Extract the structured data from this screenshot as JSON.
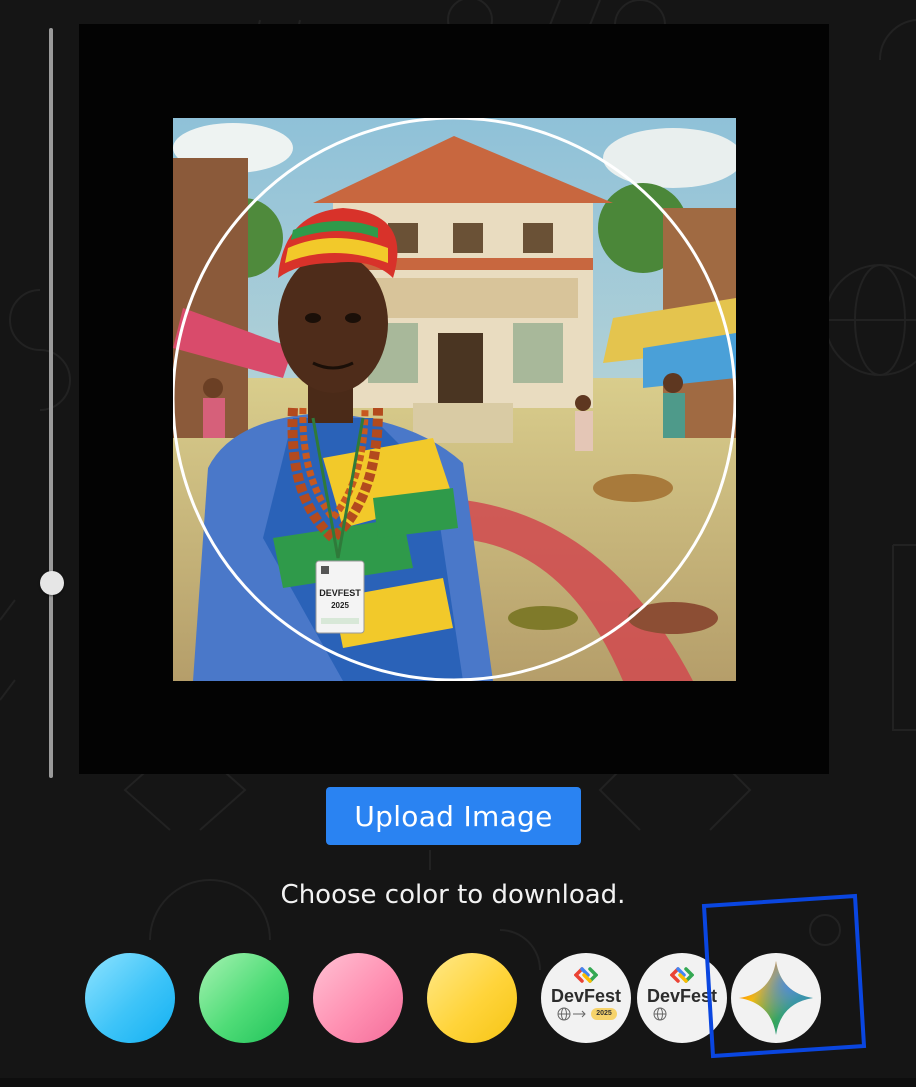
{
  "colors": {
    "background": "#151515",
    "accent": "#2a83f2",
    "highlight": "#0a46e0"
  },
  "zoom_slider": {
    "level_fraction": 0.25
  },
  "preview": {
    "frame_shape": "circle",
    "badge_line1": "DEVFEST",
    "badge_line2": "2025"
  },
  "upload_button": {
    "label": "Upload Image"
  },
  "instructions": "Choose color to download.",
  "swatches": [
    {
      "id": "blue",
      "color": "#3ec4f8"
    },
    {
      "id": "green",
      "color": "#4fdc77"
    },
    {
      "id": "pink",
      "color": "#ff90b2"
    },
    {
      "id": "yellow",
      "color": "#ffd43a"
    },
    {
      "id": "devfest-2025",
      "label": "DevFest",
      "year": "2025",
      "icon": "devfest-logo-icon"
    },
    {
      "id": "devfest-globe",
      "label": "DevFest",
      "icon": "devfest-logo-icon"
    },
    {
      "id": "gemini",
      "icon": "gemini-sparkle-icon",
      "selected": true
    }
  ]
}
